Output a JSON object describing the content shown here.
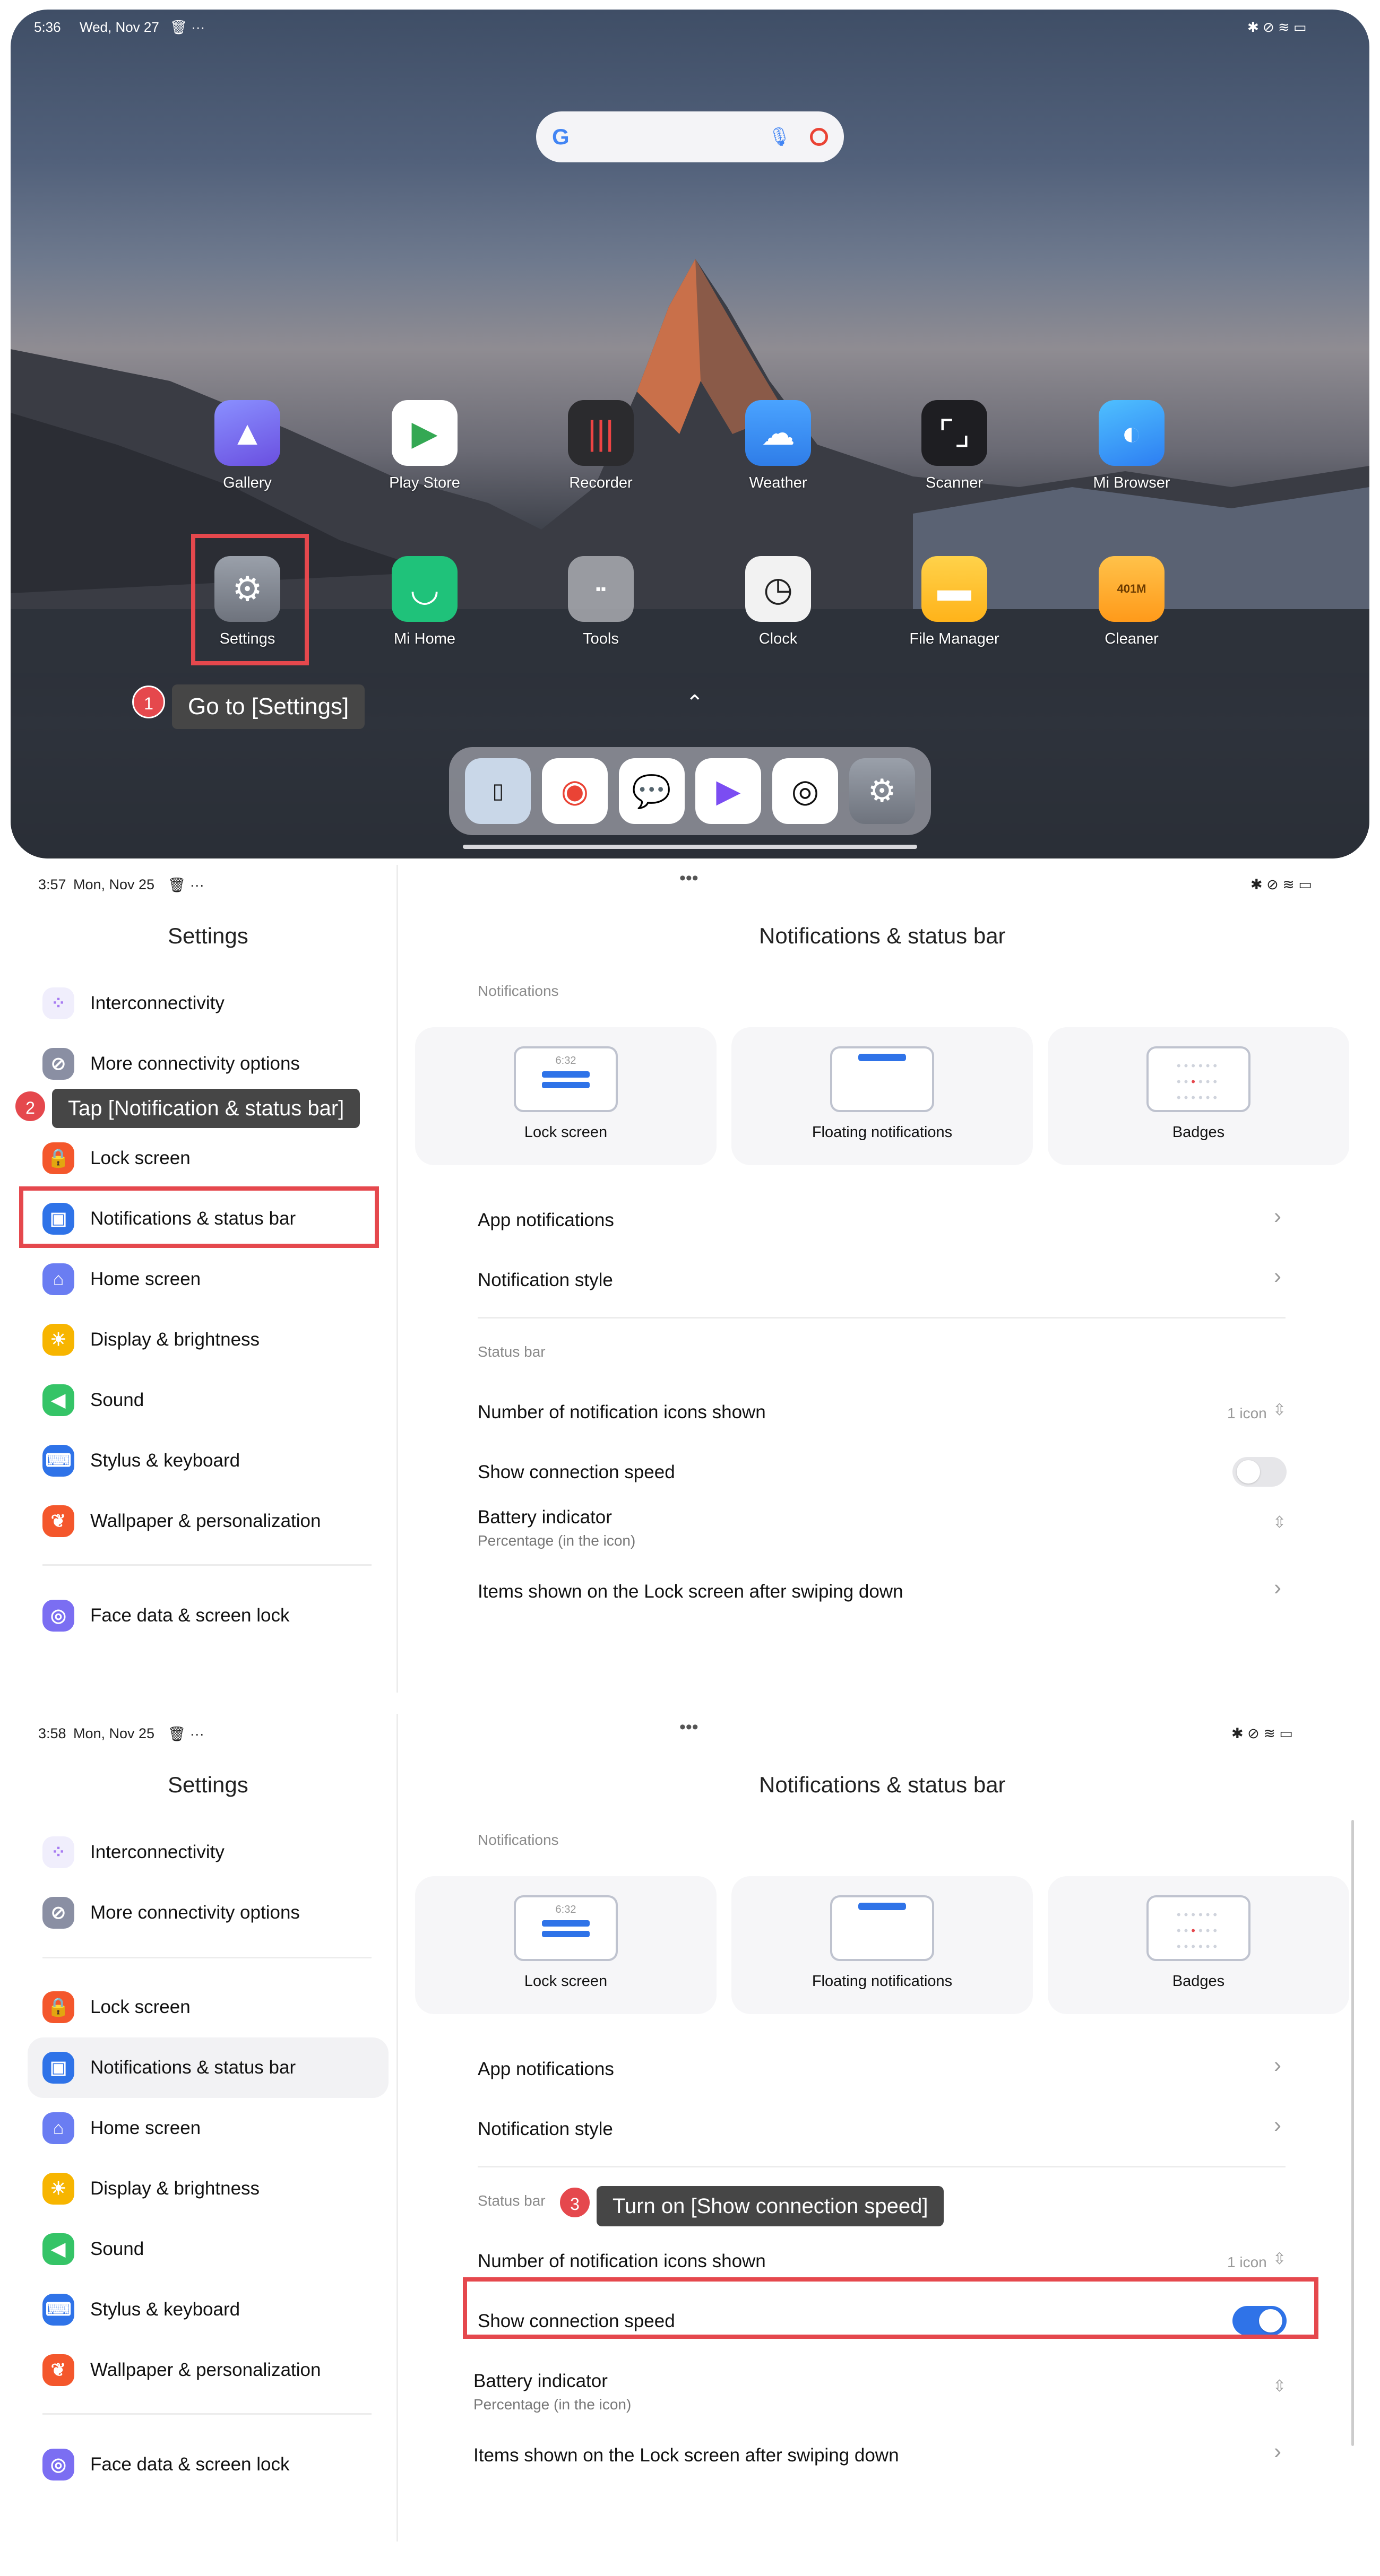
{
  "home": {
    "time": "5:36",
    "date": "Wed, Nov 27",
    "status_icons": "✱ ⊘ ≋ ▭",
    "apps_row1": [
      {
        "label": "Gallery",
        "icon": "gallery-icon",
        "color": "#6b7cf5"
      },
      {
        "label": "Play Store",
        "icon": "play-store-icon",
        "color": "#ffffff"
      },
      {
        "label": "Recorder",
        "icon": "recorder-icon",
        "color": "#2b2b2e"
      },
      {
        "label": "Weather",
        "icon": "weather-icon",
        "color": "#3d8ef2"
      },
      {
        "label": "Scanner",
        "icon": "scanner-icon",
        "color": "#1e1e22"
      },
      {
        "label": "Mi Browser",
        "icon": "browser-icon",
        "color": "#2d8cf2"
      }
    ],
    "apps_row2": [
      {
        "label": "Settings",
        "icon": "settings-icon",
        "color": "#8a8f99"
      },
      {
        "label": "Mi Home",
        "icon": "mi-home-icon",
        "color": "#1fc27a"
      },
      {
        "label": "Tools",
        "icon": "tools-folder-icon",
        "color": "#9a9ca2"
      },
      {
        "label": "Clock",
        "icon": "clock-icon",
        "color": "#f2f2f2"
      },
      {
        "label": "File Manager",
        "icon": "file-manager-icon",
        "color": "#ffc21a"
      },
      {
        "label": "Cleaner",
        "icon": "cleaner-icon",
        "color": "#ffa91f"
      }
    ],
    "cleaner_badge": "401M",
    "dock": [
      "phone-card-icon",
      "chrome-icon",
      "messages-icon",
      "video-player-icon",
      "camera-icon",
      "settings-icon"
    ]
  },
  "step1": {
    "num": "1",
    "text": "Go to [Settings]"
  },
  "step2": {
    "num": "2",
    "text": "Tap [Notification & status bar]"
  },
  "step3": {
    "num": "3",
    "text": "Turn on [Show connection speed]"
  },
  "panel2": {
    "time": "3:57",
    "date": "Mon, Nov 25"
  },
  "panel3": {
    "time": "3:58",
    "date": "Mon, Nov 25"
  },
  "settings": {
    "title": "Settings",
    "dots": "•••",
    "nav": [
      {
        "label": "Interconnectivity",
        "icon": "interconnectivity-icon"
      },
      {
        "label": "More connectivity options",
        "icon": "link-icon"
      },
      {
        "label": "Lock screen",
        "icon": "lock-icon"
      },
      {
        "label": "Notifications & status bar",
        "icon": "notification-icon"
      },
      {
        "label": "Home screen",
        "icon": "home-icon"
      },
      {
        "label": "Display & brightness",
        "icon": "sun-icon"
      },
      {
        "label": "Sound",
        "icon": "speaker-icon"
      },
      {
        "label": "Stylus & keyboard",
        "icon": "keyboard-icon"
      },
      {
        "label": "Wallpaper & personalization",
        "icon": "wallpaper-icon"
      },
      {
        "label": "Face data & screen lock",
        "icon": "face-icon"
      }
    ]
  },
  "detail": {
    "title": "Notifications & status bar",
    "section_notifications": "Notifications",
    "cards": [
      {
        "label": "Lock screen",
        "time": "6:32"
      },
      {
        "label": "Floating notifications"
      },
      {
        "label": "Badges"
      }
    ],
    "app_notifications": "App notifications",
    "notification_style": "Notification style",
    "section_status_bar": "Status bar",
    "icons_shown": "Number of notification icons shown",
    "icons_shown_value": "1 icon",
    "connection_speed": "Show connection speed",
    "battery": "Battery indicator",
    "battery_sub": "Percentage (in the icon)",
    "lock_items": "Items shown on the Lock screen after swiping down"
  },
  "state": {
    "connection_speed_panel2": false,
    "connection_speed_panel3": true
  }
}
